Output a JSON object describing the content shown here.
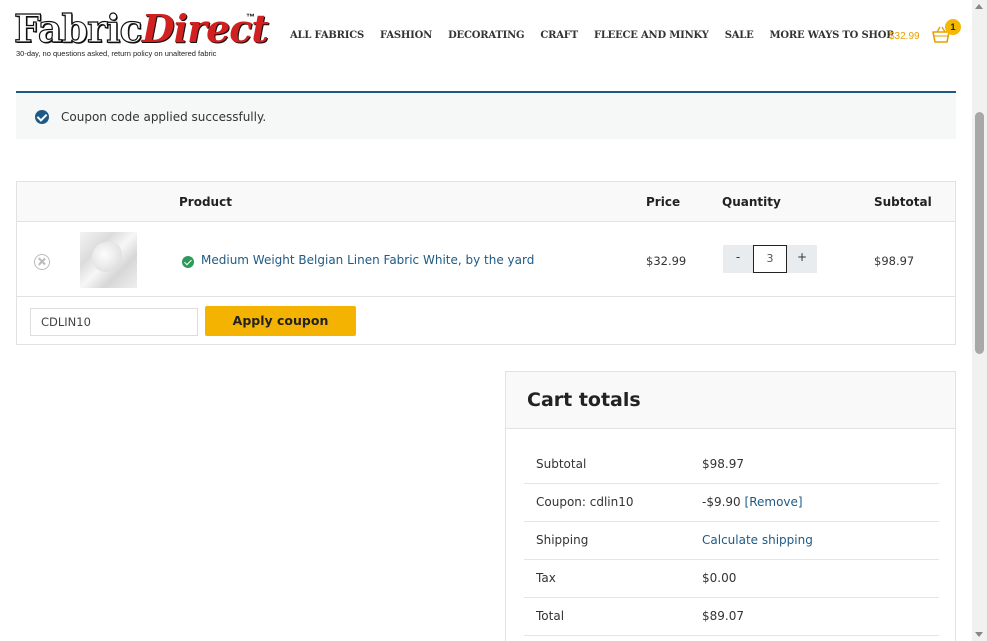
{
  "header": {
    "logo": {
      "fabric": "Fabric",
      "direct": "Direct",
      "tm": "™",
      "tagline": "30-day, no questions asked, return policy on unaltered fabric"
    },
    "nav": [
      "ALL FABRICS",
      "FASHION",
      "DECORATING",
      "CRAFT",
      "FLEECE AND MINKY",
      "SALE",
      "MORE WAYS TO SHOP"
    ],
    "cart_total": "$32.99",
    "cart_count": "1",
    "cart_icon": "basket-icon"
  },
  "notice": {
    "text": "Coupon code applied successfully.",
    "icon": "check-circle-icon",
    "color": "#1e5a85"
  },
  "cart_table": {
    "headers": {
      "product": "Product",
      "price": "Price",
      "quantity": "Quantity",
      "subtotal": "Subtotal"
    },
    "items": [
      {
        "name": "Medium Weight Belgian Linen Fabric White, by the yard",
        "price": "$32.99",
        "quantity": "3",
        "subtotal": "$98.97",
        "status_icon": "in-stock-check-icon"
      }
    ],
    "qty_minus": "-",
    "qty_plus": "+",
    "coupon_value": "CDLIN10",
    "apply_label": "Apply coupon"
  },
  "totals": {
    "title": "Cart totals",
    "rows": [
      {
        "label": "Subtotal",
        "value": "$98.97"
      },
      {
        "label": "Coupon: cdlin10",
        "value": "-$9.90",
        "link": "[Remove]"
      },
      {
        "label": "Shipping",
        "value": "Calculate shipping"
      },
      {
        "label": "Tax",
        "value": "$0.00"
      },
      {
        "label": "Total",
        "value": "$89.07"
      }
    ]
  },
  "colors": {
    "accent": "#f5b301",
    "link": "#1e5a85",
    "brand_red": "#d22020"
  }
}
